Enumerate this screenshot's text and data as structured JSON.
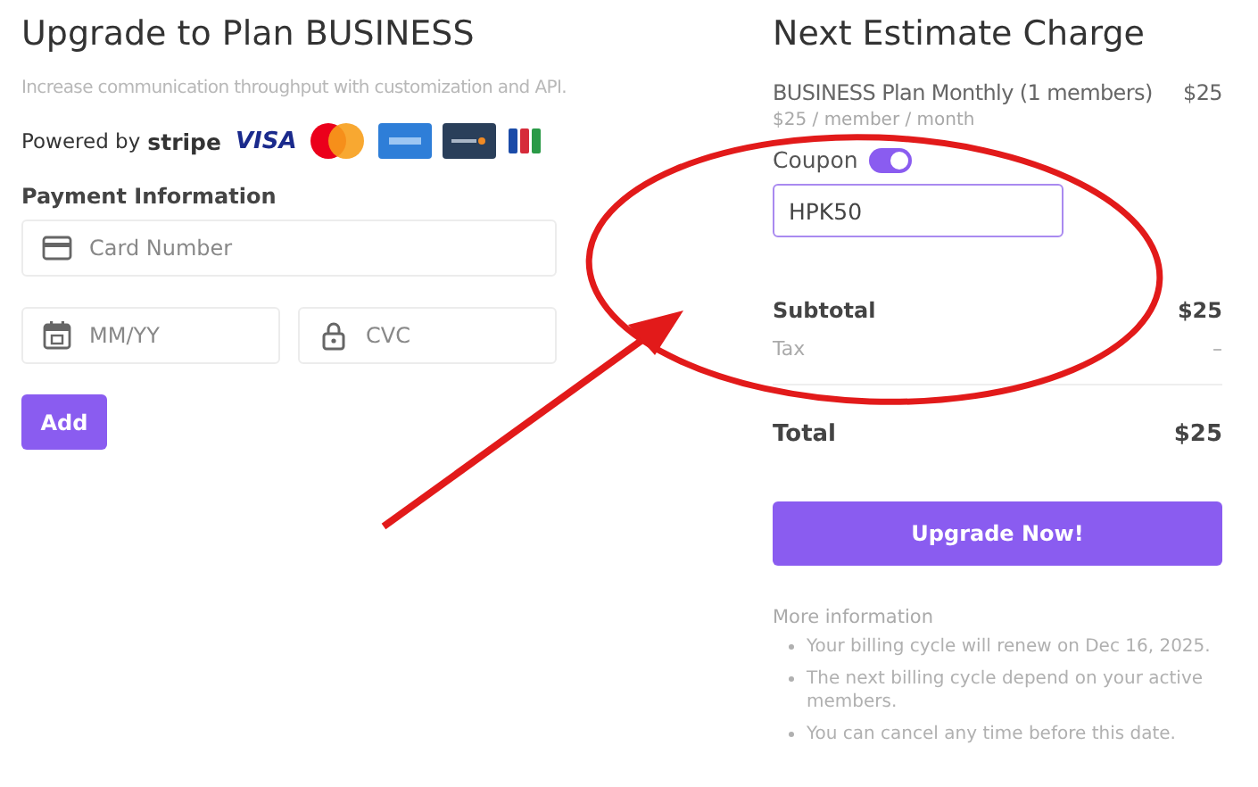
{
  "checkout": {
    "title": "Upgrade to Plan BUSINESS",
    "subtitle": "Increase communication throughput with customization and API.",
    "powered_by": {
      "label": "Powered by",
      "brand": "stripe",
      "cards": [
        {
          "kind": "visa",
          "text": "VISA"
        },
        {
          "kind": "mastercard"
        },
        {
          "kind": "amex"
        },
        {
          "kind": "discover"
        },
        {
          "kind": "jcb"
        }
      ]
    },
    "payment_heading": "Payment Information",
    "fields": [
      {
        "kind": "card",
        "placeholder": "Card Number"
      },
      {
        "kind": "date",
        "placeholder": "MM/YY"
      },
      {
        "kind": "lock",
        "placeholder": "CVC"
      }
    ],
    "add_button": "Add"
  },
  "estimate": {
    "title": "Next Estimate Charge",
    "plan": {
      "label": "BUSINESS Plan Monthly (1 members)",
      "amount": "$25",
      "rate": "$25 / member / month"
    },
    "coupon": {
      "label": "Coupon",
      "on": true,
      "value": "HPK50"
    },
    "subtotal": {
      "label": "Subtotal",
      "amount": "$25"
    },
    "tax": {
      "label": "Tax",
      "amount": "–"
    },
    "total": {
      "label": "Total",
      "amount": "$25"
    },
    "upgrade_button": "Upgrade Now!",
    "more_info": {
      "heading": "More information",
      "items": [
        "Your billing cycle will renew on Dec 16, 2025.",
        "The next billing cycle depend on your active members.",
        "You can cancel any time before this date."
      ]
    }
  },
  "annotations": {
    "ellipse": true,
    "arrow": true
  }
}
